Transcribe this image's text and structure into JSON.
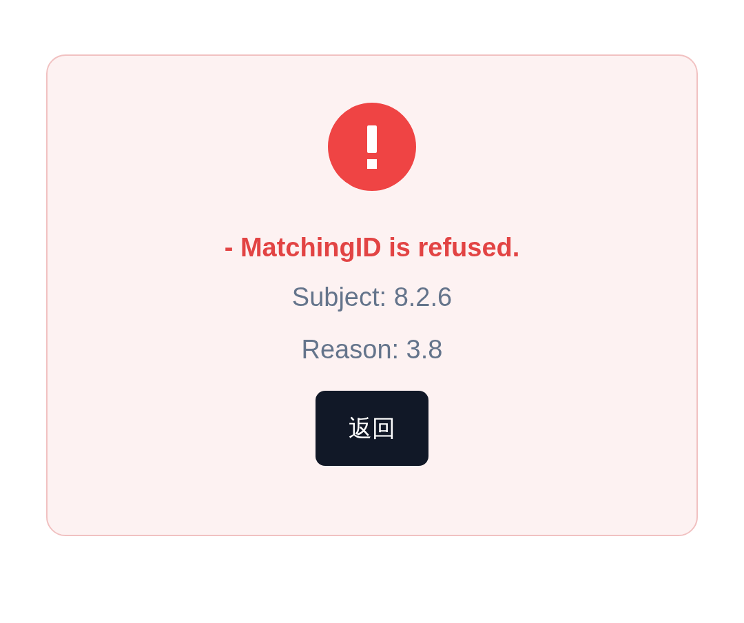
{
  "error": {
    "message": "- MatchingID is refused.",
    "details": [
      "Subject: 8.2.6",
      "Reason: 3.8"
    ],
    "button": "返回"
  }
}
